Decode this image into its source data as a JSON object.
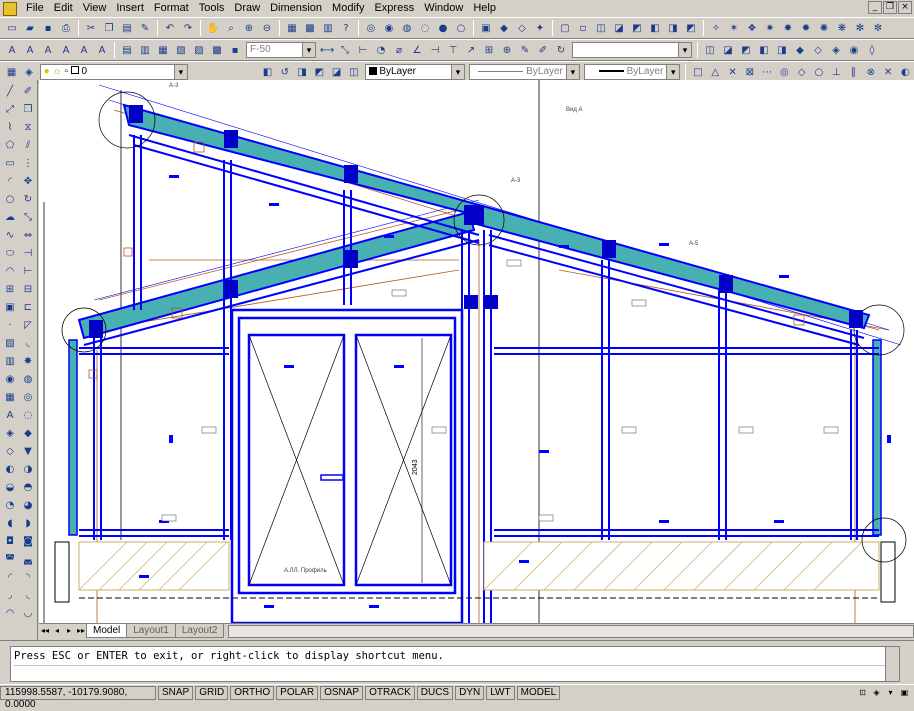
{
  "menu": {
    "items": [
      "File",
      "Edit",
      "View",
      "Insert",
      "Format",
      "Tools",
      "Draw",
      "Dimension",
      "Modify",
      "Express",
      "Window",
      "Help"
    ],
    "window_controls": [
      "_",
      "❐",
      "×"
    ]
  },
  "toolbar_std": {
    "text_style_combo": "F-50",
    "dim_style_combo": ""
  },
  "toolbar_layers": {
    "layer_name": "0",
    "color_combo": "ByLayer",
    "linetype_combo": "ByLayer",
    "lineweight_combo": "ByLayer"
  },
  "drawing": {
    "view_label": "Вид А",
    "door_dim_text": "2043",
    "callouts": [
      "А-3",
      "А-3",
      "А-5"
    ],
    "plate_text": "А.ЛЛ. Профиль"
  },
  "tabs": {
    "nav": [
      "◂◂",
      "◂",
      "▸",
      "▸▸"
    ],
    "items": [
      "Model",
      "Layout1",
      "Layout2"
    ],
    "active": "Model"
  },
  "command": {
    "prompt": "Press ESC or ENTER to exit, or right-click to display shortcut menu."
  },
  "status": {
    "coordinates": "115998.5587, -10179.9080, 0.0000",
    "toggles": [
      "SNAP",
      "GRID",
      "ORTHO",
      "POLAR",
      "OSNAP",
      "OTRACK",
      "DUCS",
      "DYN",
      "LWT",
      "MODEL"
    ]
  },
  "colors": {
    "frame_blue": "#0000ff",
    "glass_cyan": "#48b0b0",
    "dim_brown": "#b05a20",
    "hatch_olive": "#c8b060",
    "callout_gray": "#404040"
  }
}
